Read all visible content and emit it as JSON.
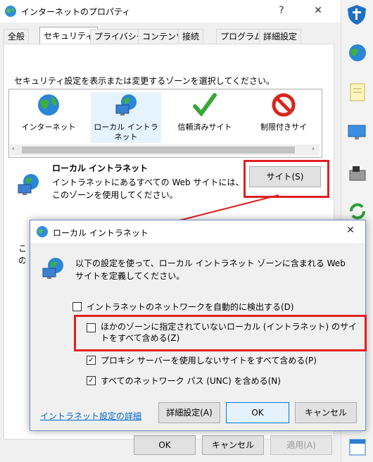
{
  "window": {
    "title": "インターネットのプロパティ",
    "help_glyph": "?",
    "close_glyph": "✕"
  },
  "tabs": [
    "全般",
    "セキュリティ",
    "プライバシー",
    "コンテンツ",
    "接続",
    "プログラム",
    "詳細設定"
  ],
  "security": {
    "instruction": "セキュリティ設定を表示または変更するゾーンを選択してください。",
    "zones": [
      "インターネット",
      "ローカル イントラネット",
      "信頼済みサイト",
      "制限付きサイ"
    ],
    "selected_zone_title": "ローカル イントラネット",
    "selected_zone_desc": "イントラネットにあるすべての Web サイトには、このゾーンを使用してください。",
    "sites_button": "サイト(S)",
    "partial_text": "この"
  },
  "main_buttons": {
    "ok": "OK",
    "cancel": "キャンセル",
    "apply": "適用(A)"
  },
  "dialog": {
    "title": "ローカル イントラネット",
    "close_glyph": "✕",
    "intro": "以下の設定を使って、ローカル イントラネット ゾーンに含まれる Web サイトを定義してください。",
    "options": [
      {
        "label": "イントラネットのネットワークを自動的に検出する(D)",
        "checked": false
      },
      {
        "label": "ほかのゾーンに指定されていないローカル (イントラネット) のサイトをすべて含める(Z)",
        "checked": false
      },
      {
        "label": "プロキシ サーバーを使用しないサイトをすべて含める(P)",
        "checked": true
      },
      {
        "label": "すべてのネットワーク パス (UNC) を含める(N)",
        "checked": true
      }
    ],
    "link": "イントラネット設定の詳細",
    "advanced_button": "詳細設定(A)",
    "ok_button": "OK",
    "cancel_button": "キャンセル"
  },
  "colors": {
    "highlight_red": "#e02020",
    "accent_blue": "#0078d7",
    "link_blue": "#0066cc"
  }
}
